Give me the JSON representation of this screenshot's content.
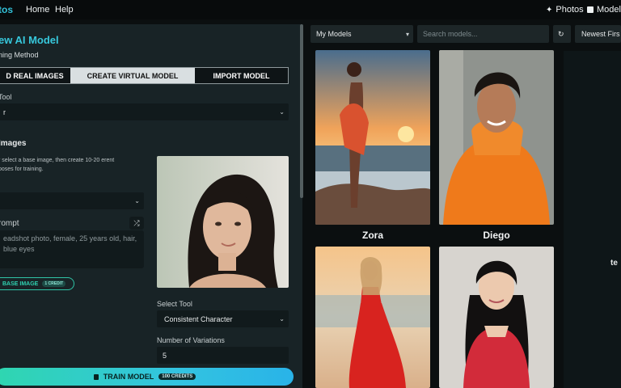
{
  "header": {
    "brand": "tos",
    "nav": [
      "Home",
      "Help"
    ],
    "right": [
      {
        "label": "Photos",
        "icon": "sparkle-icon"
      },
      {
        "label": "Models",
        "icon": "models-icon"
      }
    ]
  },
  "left": {
    "title": "ew AI Model",
    "training_label": "ning Method",
    "tabs": [
      "D REAL IMAGES",
      "CREATE VIRTUAL MODEL",
      "IMPORT MODEL"
    ],
    "tool_label": "Tool",
    "tool_value": "r",
    "section_title": "Images",
    "section_desc": "r select a base image, then create 10-20 erent poses for training.",
    "prompt_label": "rompt",
    "prompt_text": "eadshot photo, female, 25 years old, hair, blue eyes",
    "base_button": "BASE IMAGE",
    "base_badge": "1 CREDIT",
    "select_tool_label": "Select Tool",
    "select_tool_value": "Consistent Character",
    "variations_label": "Number of Variations",
    "variations_value": "5",
    "train_label": "TRAIN MODEL",
    "train_credits": "100 CREDITS"
  },
  "right": {
    "filter": "My Models",
    "search_placeholder": "Search models...",
    "sort": "Newest Firs",
    "cards": [
      {
        "name": "Zora"
      },
      {
        "name": "Diego"
      },
      {
        "name": ""
      },
      {
        "name": ""
      }
    ],
    "side_text": "te"
  }
}
